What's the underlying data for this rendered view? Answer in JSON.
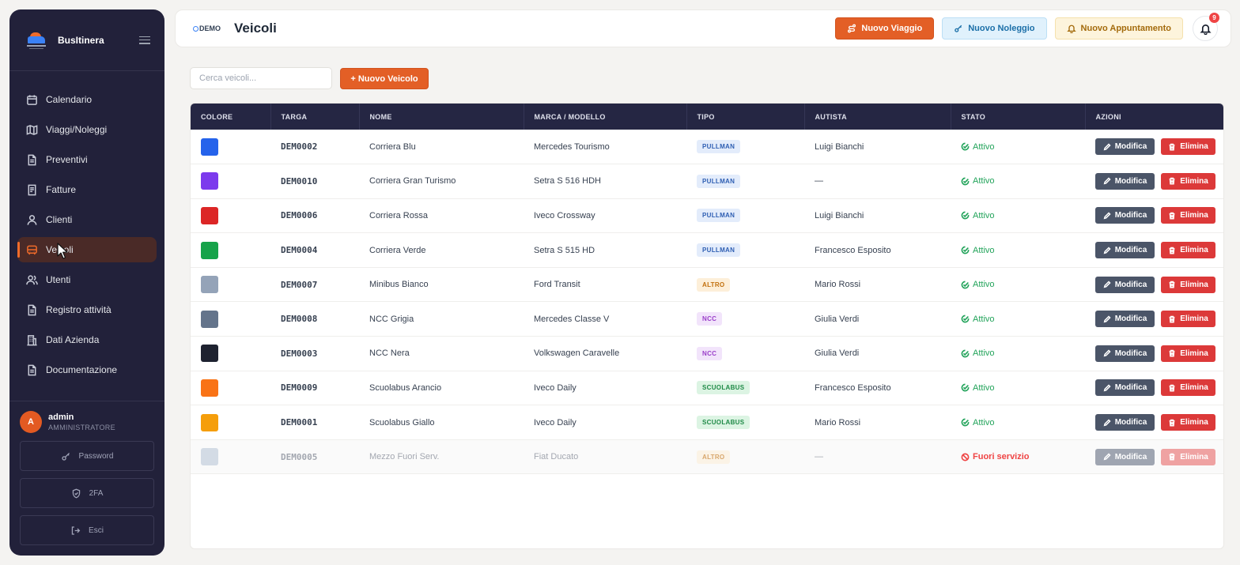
{
  "app": {
    "name": "BusItinera"
  },
  "sidebar": {
    "items": [
      {
        "label": "Calendario",
        "icon": "calendar-icon"
      },
      {
        "label": "Viaggi/Noleggi",
        "icon": "map-icon"
      },
      {
        "label": "Preventivi",
        "icon": "document-icon"
      },
      {
        "label": "Fatture",
        "icon": "receipt-icon"
      },
      {
        "label": "Clienti",
        "icon": "user-icon"
      },
      {
        "label": "Veicoli",
        "icon": "bus-icon",
        "active": true
      },
      {
        "label": "Utenti",
        "icon": "users-icon"
      },
      {
        "label": "Registro attività",
        "icon": "log-icon"
      },
      {
        "label": "Dati Azienda",
        "icon": "building-icon"
      },
      {
        "label": "Documentazione",
        "icon": "docs-icon"
      }
    ],
    "user": {
      "initial": "A",
      "name": "admin",
      "role": "AMMINISTRATORE"
    },
    "buttons": {
      "password": "Password",
      "twofa": "2FA",
      "logout": "Esci"
    }
  },
  "header": {
    "demo_label": "DEMO",
    "title": "Veicoli",
    "buttons": {
      "new_trip": "Nuovo Viaggio",
      "new_rental": "Nuovo Noleggio",
      "new_appointment": "Nuovo Appuntamento"
    },
    "notifications_count": "9"
  },
  "toolbar": {
    "search_placeholder": "Cerca veicoli...",
    "add_label": "+ Nuovo Veicolo"
  },
  "table": {
    "columns": [
      "COLORE",
      "TARGA",
      "NOME",
      "MARCA / MODELLO",
      "TIPO",
      "AUTISTA",
      "STATO",
      "AZIONI"
    ],
    "edit_label": "Modifica",
    "delete_label": "Elimina",
    "rows": [
      {
        "color": "#2563eb",
        "plate": "DEM0002",
        "name": "Corriera Blu",
        "model": "Mercedes Tourismo",
        "type": "PULLMAN",
        "driver": "Luigi Bianchi",
        "status": "Attivo"
      },
      {
        "color": "#7c3aed",
        "plate": "DEM0010",
        "name": "Corriera Gran Turismo",
        "model": "Setra S 516 HDH",
        "type": "PULLMAN",
        "driver": "—",
        "status": "Attivo"
      },
      {
        "color": "#dc2626",
        "plate": "DEM0006",
        "name": "Corriera Rossa",
        "model": "Iveco Crossway",
        "type": "PULLMAN",
        "driver": "Luigi Bianchi",
        "status": "Attivo"
      },
      {
        "color": "#16a34a",
        "plate": "DEM0004",
        "name": "Corriera Verde",
        "model": "Setra S 515 HD",
        "type": "PULLMAN",
        "driver": "Francesco Esposito",
        "status": "Attivo"
      },
      {
        "color": "#94a3b8",
        "plate": "DEM0007",
        "name": "Minibus Bianco",
        "model": "Ford Transit",
        "type": "ALTRO",
        "driver": "Mario Rossi",
        "status": "Attivo"
      },
      {
        "color": "#64748b",
        "plate": "DEM0008",
        "name": "NCC Grigia",
        "model": "Mercedes Classe V",
        "type": "NCC",
        "driver": "Giulia Verdi",
        "status": "Attivo"
      },
      {
        "color": "#1e2230",
        "plate": "DEM0003",
        "name": "NCC Nera",
        "model": "Volkswagen Caravelle",
        "type": "NCC",
        "driver": "Giulia Verdi",
        "status": "Attivo"
      },
      {
        "color": "#f97316",
        "plate": "DEM0009",
        "name": "Scuolabus Arancio",
        "model": "Iveco Daily",
        "type": "SCUOLABUS",
        "driver": "Francesco Esposito",
        "status": "Attivo"
      },
      {
        "color": "#f59e0b",
        "plate": "DEM0001",
        "name": "Scuolabus Giallo",
        "model": "Iveco Daily",
        "type": "SCUOLABUS",
        "driver": "Mario Rossi",
        "status": "Attivo"
      },
      {
        "color": "#cbd5e1",
        "plate": "DEM0005",
        "name": "Mezzo Fuori Serv.",
        "model": "Fiat Ducato",
        "type": "ALTRO",
        "driver": "—",
        "status": "Fuori servizio",
        "disabled": true
      }
    ]
  },
  "colors": {
    "accent": "#e35f26",
    "sidebar_bg": "#22213a",
    "table_header_bg": "#252643",
    "status_active": "#22a35a",
    "status_off": "#ef4444"
  }
}
